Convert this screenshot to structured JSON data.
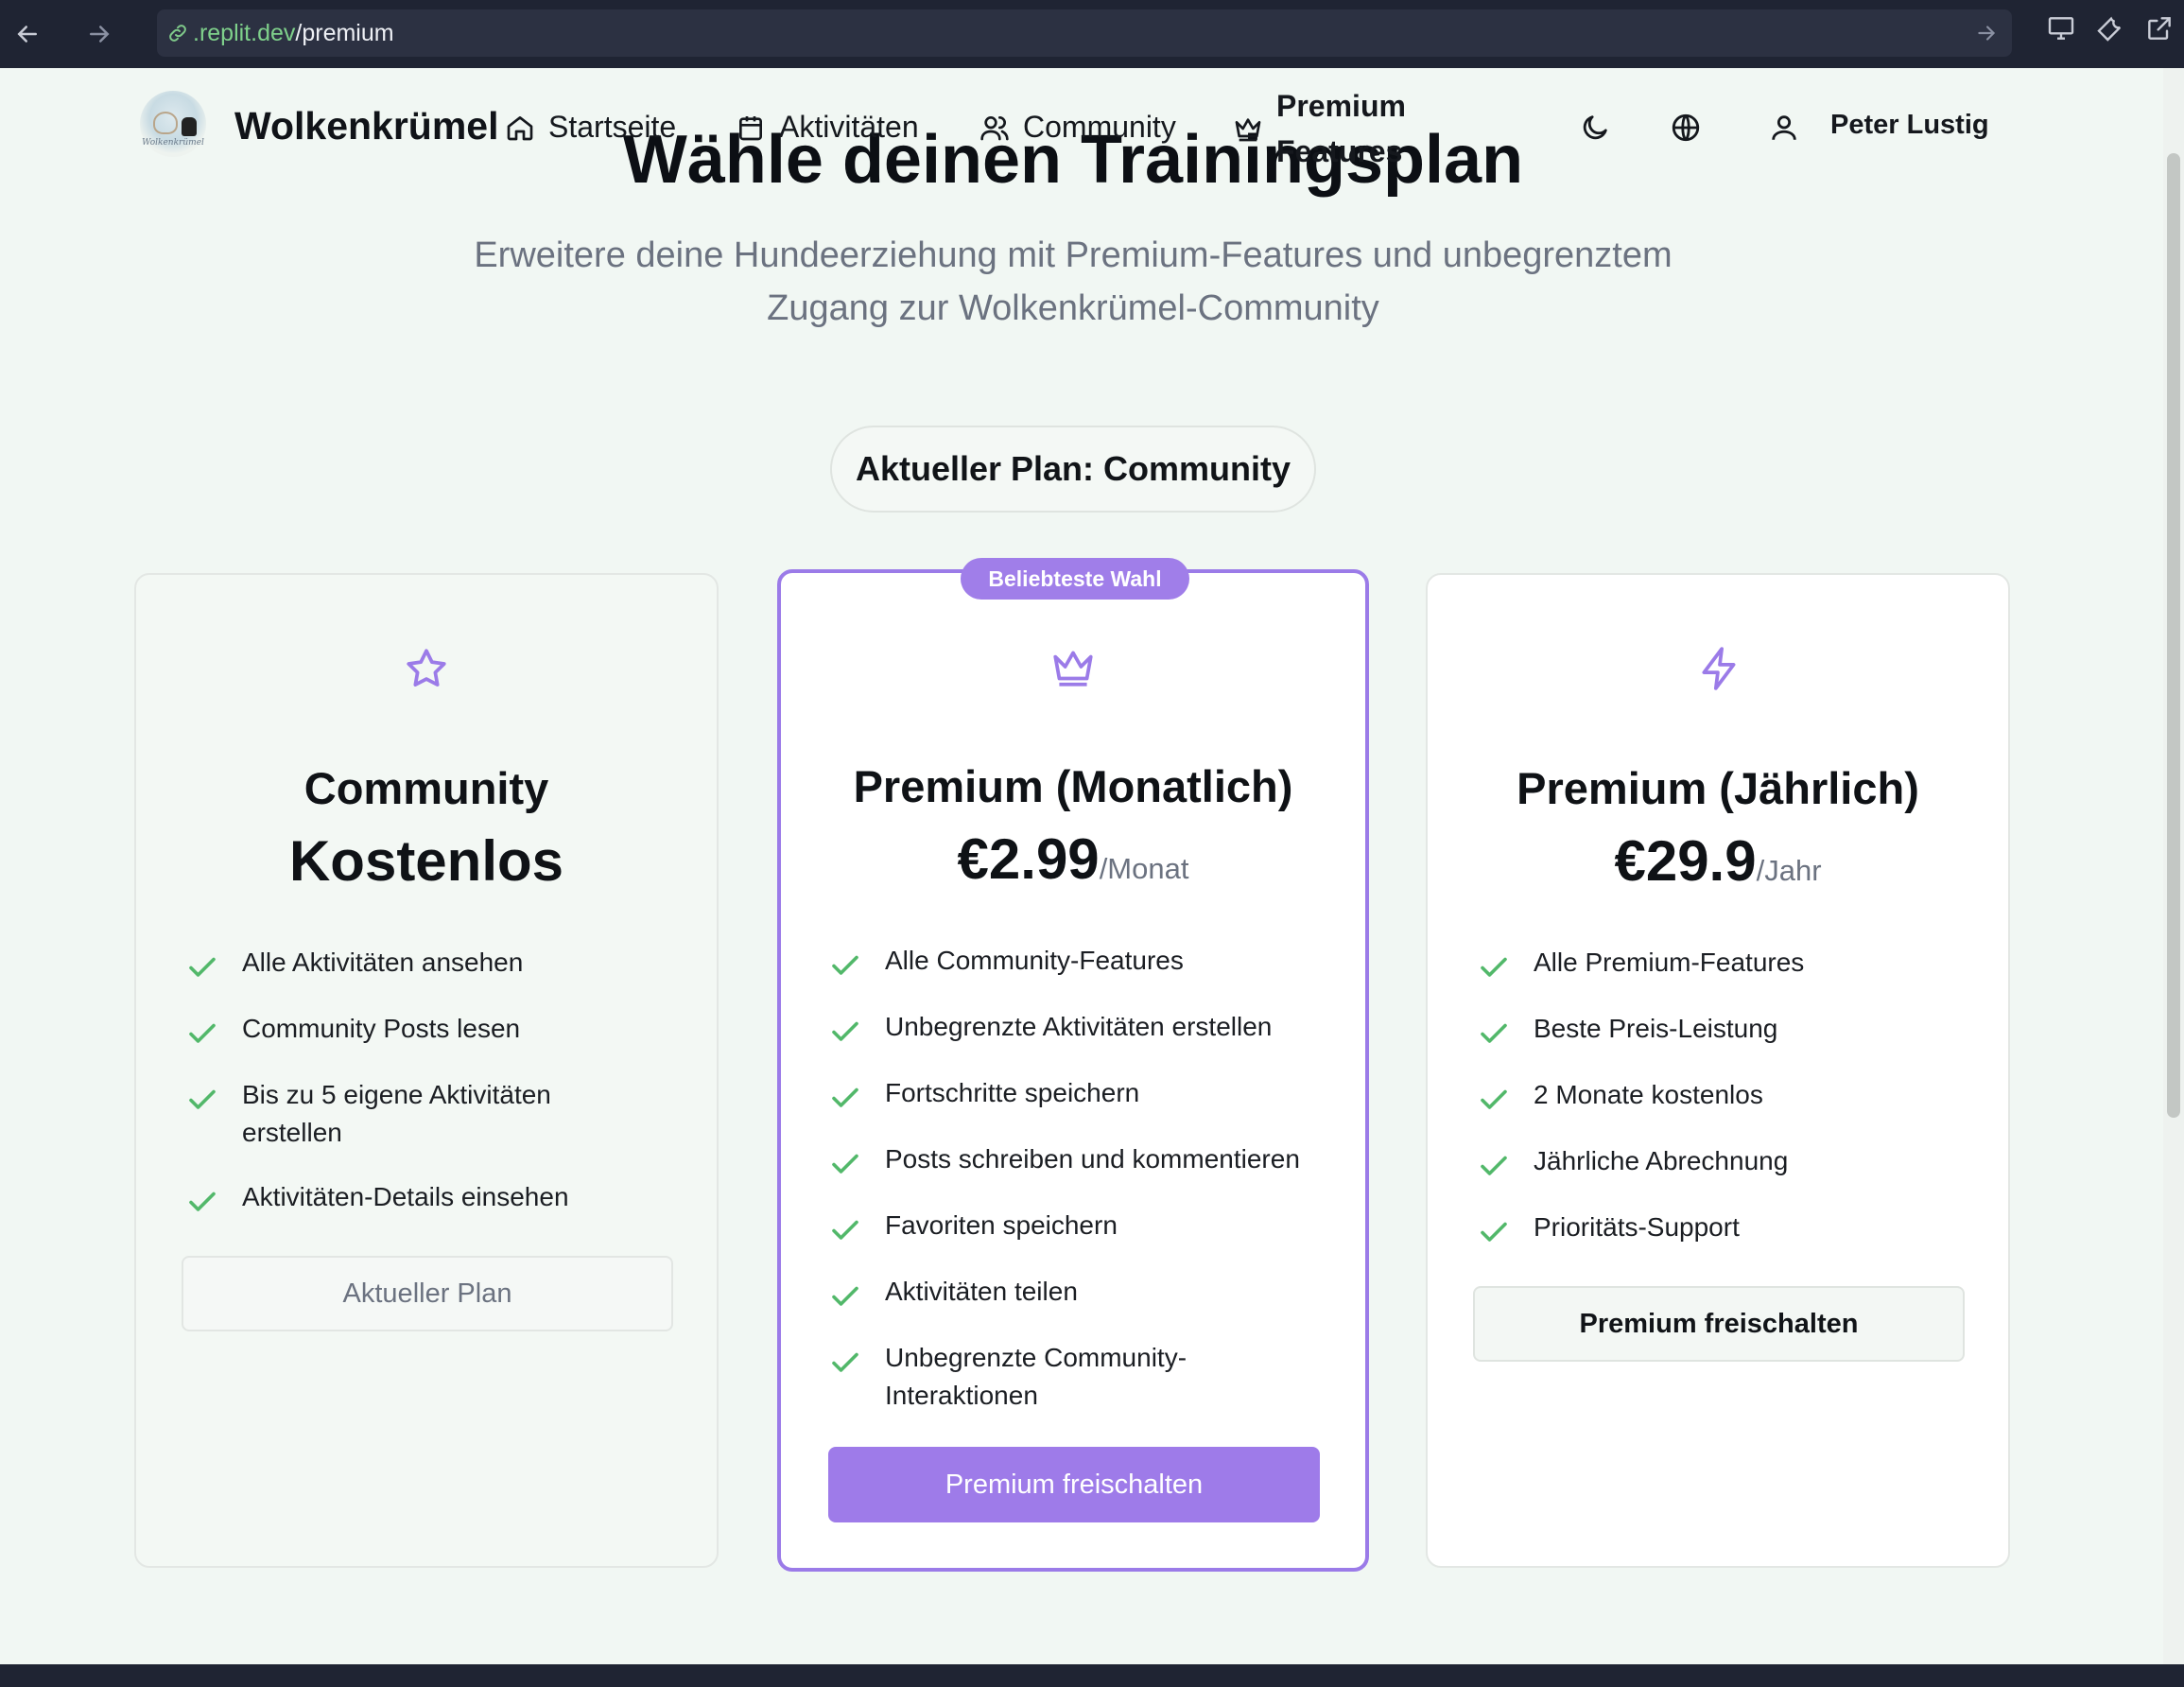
{
  "browser": {
    "url_host": ".replit.dev",
    "url_path": "/premium"
  },
  "header": {
    "brand": "Wolkenkrümel",
    "logo_text": "Wolkenkrümel",
    "nav": {
      "home": "Startseite",
      "activities": "Aktivitäten",
      "community": "Community",
      "premium_line1": "Premium",
      "premium_line2": "Features"
    },
    "user_name": "Peter Lustig"
  },
  "hero": {
    "title": "Wähle deinen Trainingsplan",
    "subtitle": "Erweitere deine Hundeerziehung mit Premium-Features und unbegrenztem Zugang zur Wolkenkrümel-Community",
    "current_plan": "Aktueller Plan: Community"
  },
  "plans": [
    {
      "icon": "star-icon",
      "title": "Community",
      "price": "Kostenlos",
      "period": "",
      "features": [
        "Alle Aktivitäten ansehen",
        "Community Posts lesen",
        "Bis zu 5 eigene Aktivitäten erstellen",
        "Aktivitäten-Details einsehen"
      ],
      "button": "Aktueller Plan"
    },
    {
      "icon": "crown-icon",
      "badge": "Beliebteste Wahl",
      "title": "Premium (Monatlich)",
      "price": "€2.99",
      "period": "/Monat",
      "features": [
        "Alle Community-Features",
        "Unbegrenzte Aktivitäten erstellen",
        "Fortschritte speichern",
        "Posts schreiben und kommentieren",
        "Favoriten speichern",
        "Aktivitäten teilen",
        "Unbegrenzte Community-Interaktionen"
      ],
      "button": "Premium freischalten"
    },
    {
      "icon": "lightning-icon",
      "title": "Premium (Jährlich)",
      "price": "€29.9",
      "period": "/Jahr",
      "features": [
        "Alle Premium-Features",
        "Beste Preis-Leistung",
        "2 Monate kostenlos",
        "Jährliche Abrechnung",
        "Prioritäts-Support"
      ],
      "button": "Premium freischalten"
    }
  ],
  "colors": {
    "accent": "#9e7be9",
    "check": "#52b86a",
    "page_bg": "#f1f7f3"
  }
}
